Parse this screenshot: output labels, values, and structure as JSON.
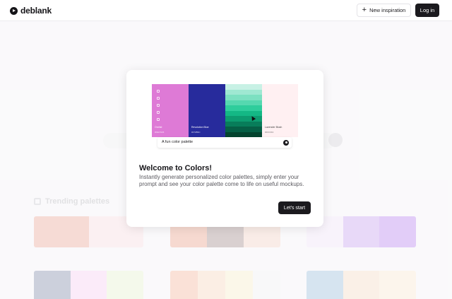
{
  "header": {
    "logo_text": "deblank",
    "new_inspiration_label": "New inspiration",
    "login_label": "Log in"
  },
  "background": {
    "trending_label": "Trending palettes",
    "palettes": [
      [
        "#e8907a",
        "#f8d5da"
      ],
      [
        "#e88d6b",
        "#8a6e6a",
        "#f4c9b7"
      ],
      [
        "#f1e1f7",
        "#bb8cef",
        "#a765ef"
      ],
      [
        "#5e6e94",
        "#fbc7f5",
        "#e5f4c4"
      ],
      [
        "#f7a484",
        "#fbd1ad",
        "#fbeec0",
        "#f1f2f4"
      ],
      [
        "#7fb0d4",
        "#f7d6b7",
        "#fde7c9"
      ]
    ]
  },
  "modal": {
    "swatches": [
      {
        "name": "Orchid",
        "hex": "#DE7AD6",
        "color": "#de7ad6"
      },
      {
        "name": "Revolution Blue",
        "hex": "#272B9C",
        "color": "#272b9c"
      },
      {
        "name": "",
        "hex": "",
        "color": "#1fc495"
      },
      {
        "name": "Lavender Blush",
        "hex": "#FFF0F2",
        "color": "#fff0f2"
      }
    ],
    "green_shades": [
      "#c8f1e5",
      "#9fe8d2",
      "#7ce0c1",
      "#56d8b0",
      "#2fcd9c",
      "#14b885",
      "#0d9c70",
      "#087d5a",
      "#065f45",
      "#04442f"
    ],
    "prompt_text": "A fun color palette",
    "title": "Welcome to Colors!",
    "description": "Instantly generate personalized color palettes, simply enter your prompt and see your color palette come to life on useful mockups.",
    "start_label": "Let's start"
  }
}
